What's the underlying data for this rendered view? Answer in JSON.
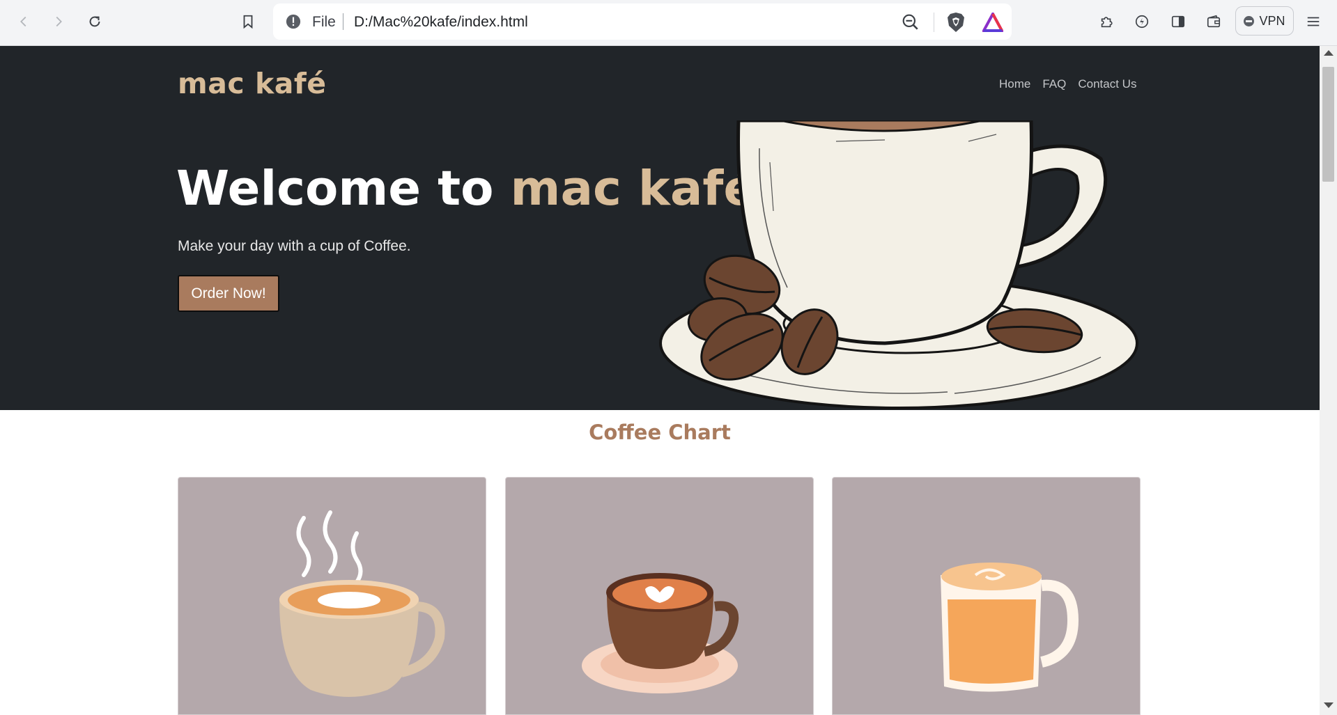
{
  "browser": {
    "url_scheme": "File",
    "url": "D:/Mac%20kafe/index.html",
    "vpn_label": "VPN",
    "icons": [
      "back-icon",
      "forward-icon",
      "reload-icon",
      "bookmark-icon",
      "info-icon",
      "zoom-out-icon",
      "brave-shields-icon",
      "brave-rewards-icon",
      "extensions-icon",
      "leo-icon",
      "sidebar-icon",
      "wallet-icon",
      "menu-icon"
    ]
  },
  "site": {
    "brand": "mac kafé",
    "nav": [
      "Home",
      "FAQ",
      "Contact Us"
    ],
    "hero": {
      "title_prefix": "Welcome to",
      "title_accent": "mac kafé",
      "subtitle": "Make your day with a cup of Coffee.",
      "cta": "Order Now!"
    },
    "section_title": "Coffee Chart"
  },
  "colors": {
    "hero_bg": "#212529",
    "brand_accent": "#d8bc98",
    "button_bg": "#a97b5e",
    "card_bg": "#b4a8ab"
  }
}
